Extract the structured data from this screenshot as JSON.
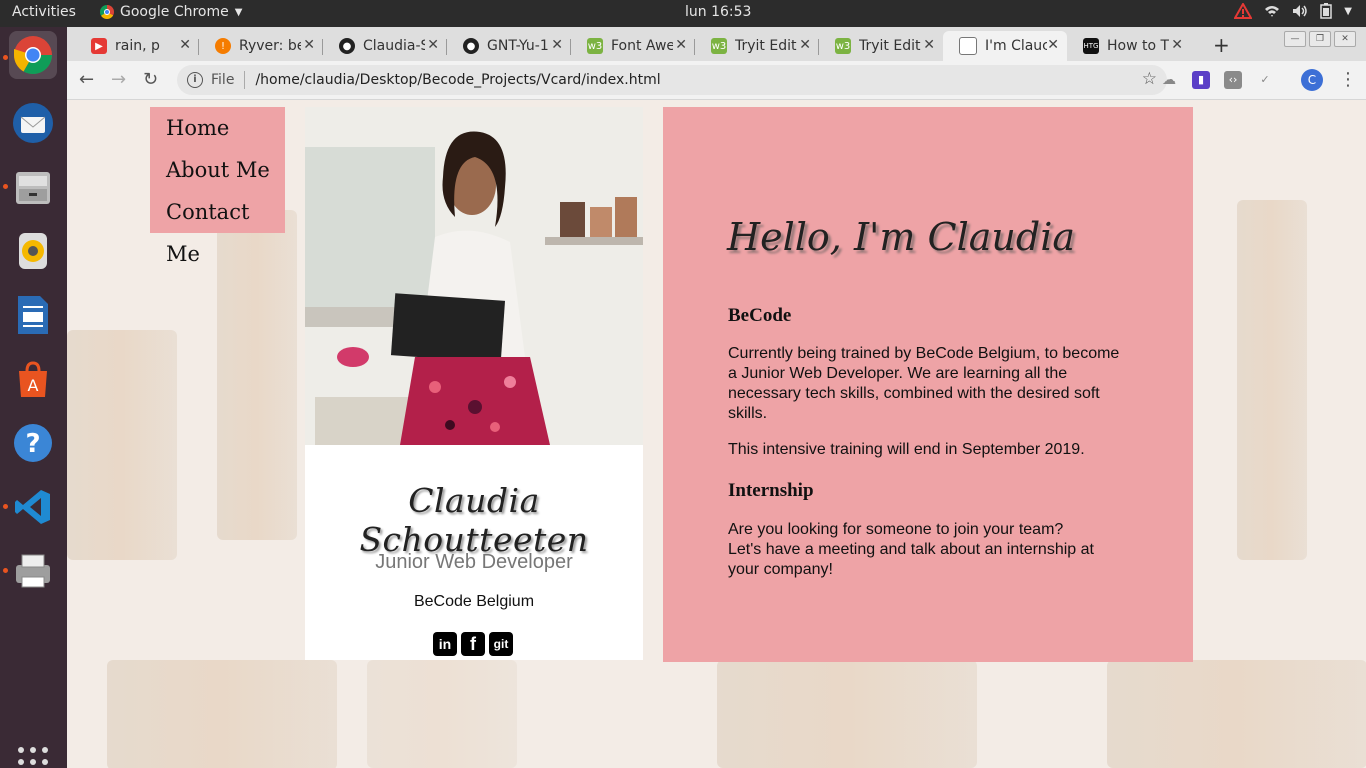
{
  "topbar": {
    "activities": "Activities",
    "app_name": "Google Chrome",
    "clock": "lun 16:53"
  },
  "dock": {
    "items": [
      {
        "icon": "chrome-icon"
      },
      {
        "icon": "thunderbird-icon"
      },
      {
        "icon": "files-icon"
      },
      {
        "icon": "rhythmbox-icon"
      },
      {
        "icon": "writer-icon"
      },
      {
        "icon": "software-icon"
      },
      {
        "icon": "help-icon"
      },
      {
        "icon": "vscode-icon"
      },
      {
        "icon": "printer-icon"
      }
    ]
  },
  "tabs": [
    {
      "title": "rain, p",
      "color": "#e53935",
      "glyph": "▶"
    },
    {
      "title": "Ryver: be",
      "color": "#f57c00",
      "glyph": "!"
    },
    {
      "title": "Claudia-S",
      "color": "#222222",
      "glyph": "●"
    },
    {
      "title": "GNT-Yu-1",
      "color": "#222222",
      "glyph": "●"
    },
    {
      "title": "Font Awe",
      "color": "#7cb342",
      "glyph": "w3"
    },
    {
      "title": "Tryit Edit",
      "color": "#7cb342",
      "glyph": "w3"
    },
    {
      "title": "Tryit Edit",
      "color": "#7cb342",
      "glyph": "w3"
    },
    {
      "title": "I'm Clauc",
      "color": "#ffffff",
      "glyph": "▢"
    },
    {
      "title": "How to T",
      "color": "#111111",
      "glyph": "HTG"
    }
  ],
  "omnibox": {
    "scheme": "File",
    "url": "/home/claudia/Desktop/Becode_Projects/Vcard/index.html"
  },
  "profile_initial": "C",
  "nav": {
    "items": [
      "Home",
      "About Me",
      "Contact Me"
    ]
  },
  "card": {
    "name": "Claudia Schoutteeten",
    "role": "Junior Web Developer",
    "org": "BeCode Belgium",
    "socials": [
      {
        "icon": "linkedin-icon",
        "label": "in"
      },
      {
        "icon": "facebook-icon",
        "label": "f"
      },
      {
        "icon": "git-icon",
        "label": "git"
      }
    ]
  },
  "about": {
    "greeting": "Hello, I'm Claudia",
    "section1_title": "BeCode",
    "section1_p1": "Currently being trained by BeCode Belgium, to become a Junior Web Developer. We are learning all the necessary tech skills, combined with the desired soft skills.",
    "section1_p2": "This intensive training will end in September 2019.",
    "section2_title": "Internship",
    "section2_p1": "Are you looking for someone to join your team?",
    "section2_p2": "Let's have a meeting and talk about an internship at your company!"
  },
  "colors": {
    "accent_pink": "#eea3a6",
    "dock_bg": "#3a2a35",
    "topbar_bg": "#2c2c2c"
  }
}
